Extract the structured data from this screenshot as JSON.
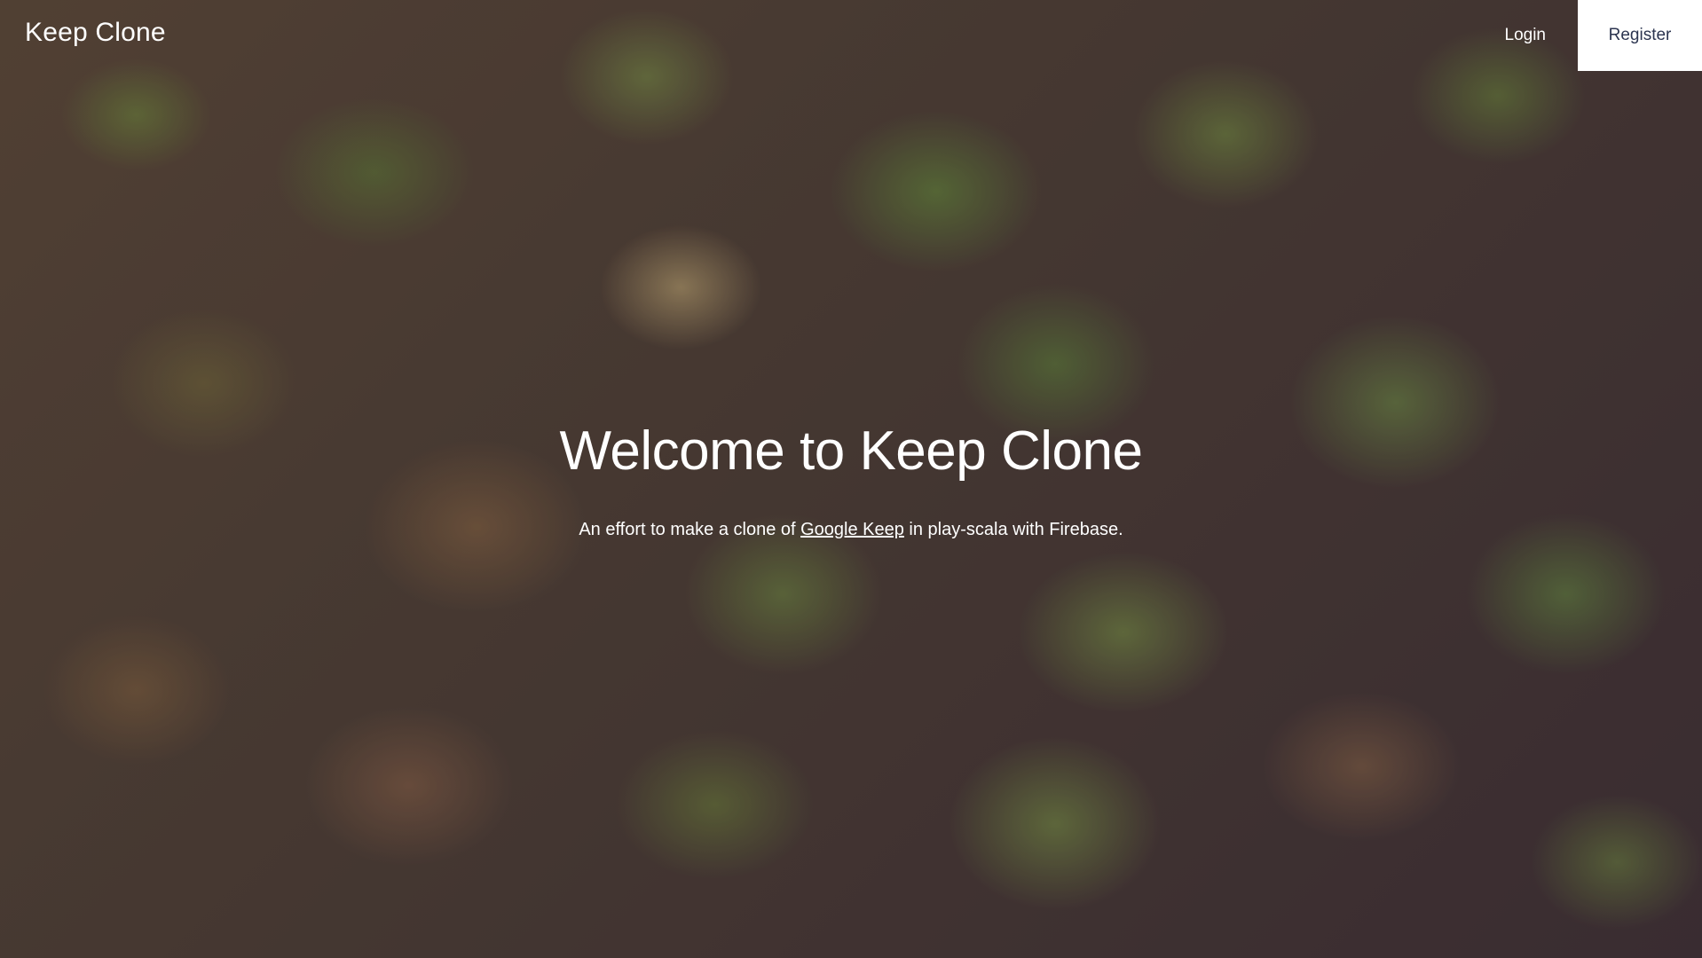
{
  "nav": {
    "brand": "Keep Clone",
    "login_label": "Login",
    "register_label": "Register"
  },
  "hero": {
    "title": "Welcome to Keep Clone",
    "subtitle_before": "An effort to make a clone of ",
    "subtitle_link": "Google Keep",
    "subtitle_after": " in play-scala with Firebase."
  },
  "background": {
    "description_color": "#4a3a34",
    "register_text_color": "#2c3550"
  }
}
